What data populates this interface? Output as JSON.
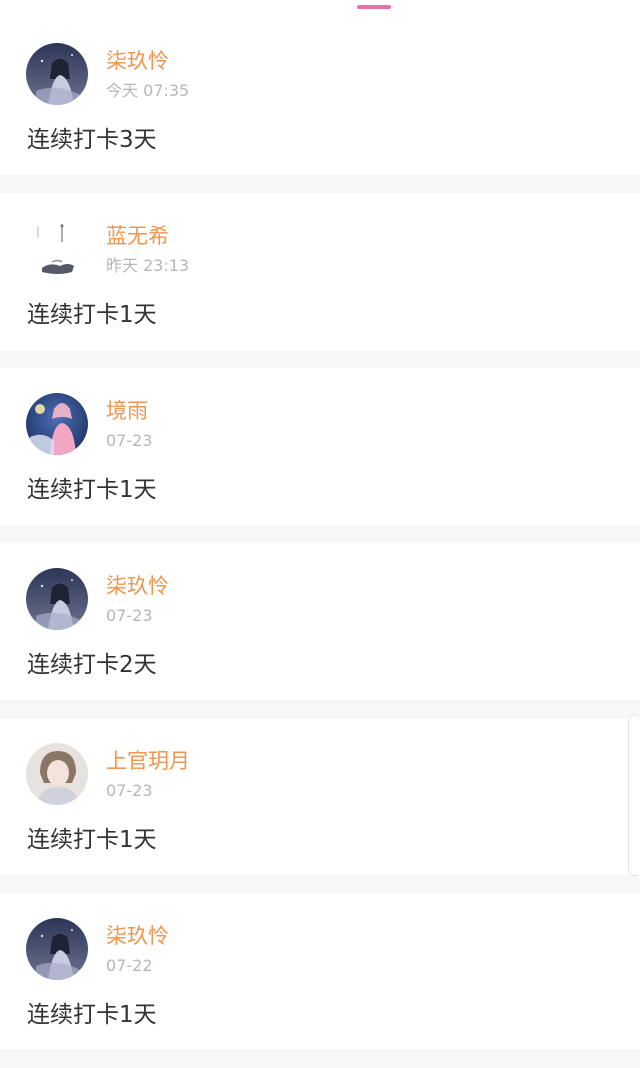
{
  "colors": {
    "accent": "#ea6fa6",
    "username": "#f0964f",
    "timestamp": "#b7b7b7",
    "text": "#333333"
  },
  "posts": [
    {
      "user": "柒玖怜",
      "time": "今天 07:35",
      "text": "连续打卡3天",
      "avatar": "avatar-moon-girl"
    },
    {
      "user": "蓝无希",
      "time": "昨天 23:13",
      "text": "连续打卡1天",
      "avatar": "avatar-sketch"
    },
    {
      "user": "境雨",
      "time": "07-23",
      "text": "连续打卡1天",
      "avatar": "avatar-pink-princess"
    },
    {
      "user": "柒玖怜",
      "time": "07-23",
      "text": "连续打卡2天",
      "avatar": "avatar-moon-girl"
    },
    {
      "user": "上官玥月",
      "time": "07-23",
      "text": "连续打卡1天",
      "avatar": "avatar-portrait"
    },
    {
      "user": "柒玖怜",
      "time": "07-22",
      "text": "连续打卡1天",
      "avatar": "avatar-moon-girl"
    }
  ]
}
